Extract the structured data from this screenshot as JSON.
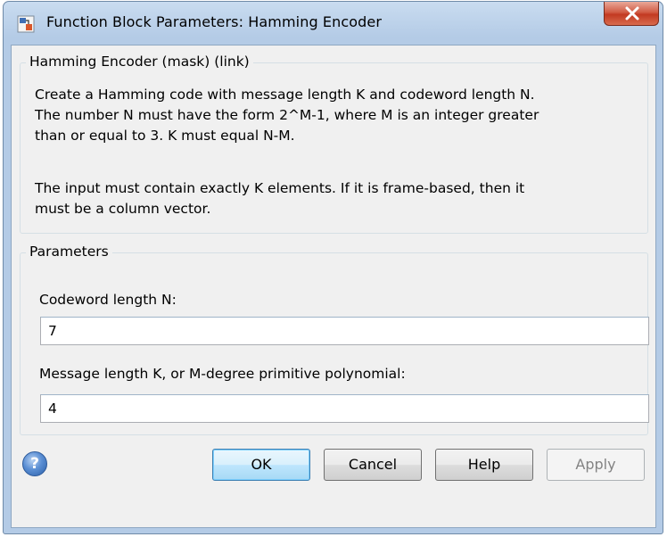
{
  "window": {
    "title": "Function Block Parameters: Hamming Encoder",
    "icon": "simulink-block-icon"
  },
  "description_group": {
    "legend": "Hamming Encoder (mask) (link)",
    "lines": [
      "Create a Hamming code with message length K and codeword length N.",
      "The number N must have the form 2^M-1, where M is an integer greater",
      "than or equal to 3.  K must equal N-M.",
      "",
      "The input must contain exactly K elements.  If it is frame-based, then it",
      "must be a column vector."
    ]
  },
  "parameters_group": {
    "legend": "Parameters",
    "codeword_label": "Codeword length N:",
    "codeword_value": "7",
    "message_label": "Message length K, or M-degree primitive polynomial:",
    "message_value": "4"
  },
  "buttons": {
    "ok": "OK",
    "cancel": "Cancel",
    "help": "Help",
    "apply": "Apply",
    "help_icon_glyph": "?"
  }
}
